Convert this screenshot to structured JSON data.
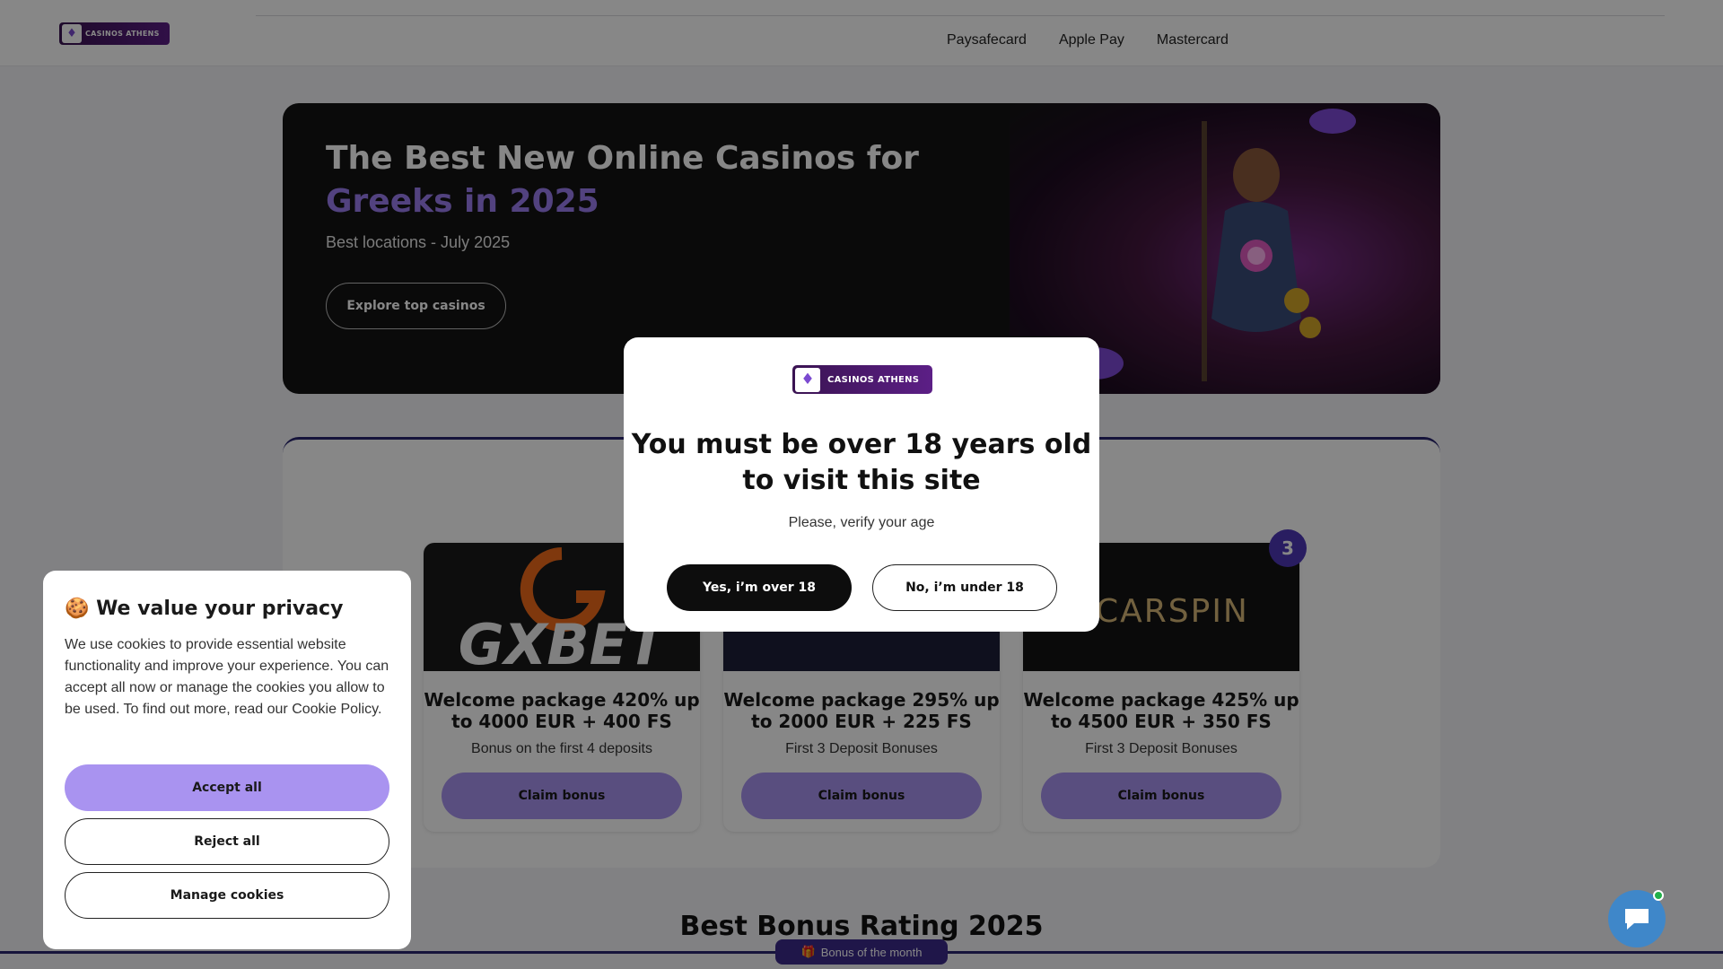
{
  "header": {
    "logo_text": "CASINOS ATHENS",
    "nav": [
      "Paysafecard",
      "Apple Pay",
      "Mastercard"
    ]
  },
  "hero": {
    "title_line1": "The Best New Online Casinos for",
    "title_line2": "Greeks in 2025",
    "subtitle": "Best locations - July 2025",
    "cta": "Explore top casinos"
  },
  "cards": [
    {
      "brand": "GXBET",
      "title": "Welcome package 420% up to 4000 EUR + 400 FS",
      "desc": "Bonus on the first 4 deposits",
      "cta": "Claim bonus"
    },
    {
      "brand": "",
      "title": "Welcome package 295% up to 2000 EUR + 225 FS",
      "desc": "First 3 Deposit Bonuses",
      "cta": "Claim bonus"
    },
    {
      "brand": "SCARSPIN",
      "rank": "3",
      "title": "Welcome package 425% up to 4500 EUR + 350 FS",
      "desc": "First 3 Deposit Bonuses",
      "cta": "Claim bonus"
    }
  ],
  "section": {
    "title": "Best Bonus Rating 2025",
    "badge": "Bonus of the month"
  },
  "cookie": {
    "title": "We value your privacy",
    "body": "We use cookies to provide essential website functionality and improve your experience. You can accept all now or manage the cookies you allow to be used. To find out more, read our Cookie Policy.",
    "accept": "Accept all",
    "reject": "Reject all",
    "manage": "Manage cookies"
  },
  "modal": {
    "logo_text": "CASINOS ATHENS",
    "title": "You must be over 18 years old to visit this site",
    "subtitle": "Please, verify your age",
    "yes": "Yes, i’m over 18",
    "no": "No, i’m under 18"
  },
  "colors": {
    "accent": "#a993f0",
    "brand_purple": "#4f38b8",
    "dark": "#141414"
  }
}
